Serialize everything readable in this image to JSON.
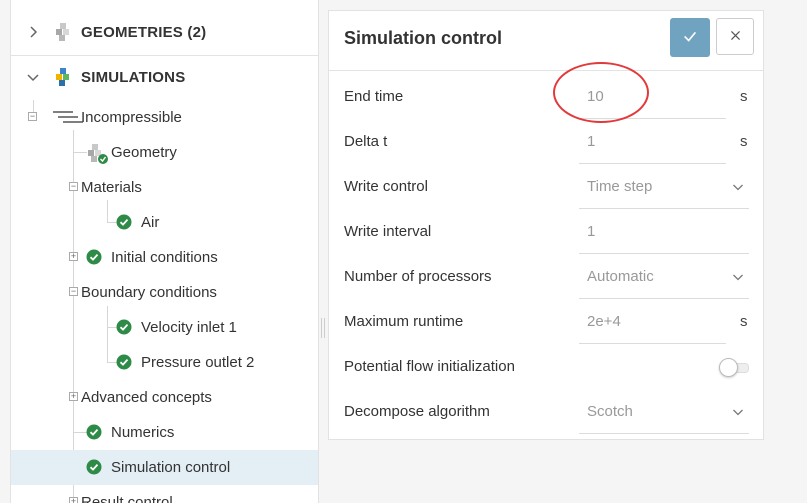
{
  "tree": {
    "geometries_label": "GEOMETRIES (2)",
    "simulations_label": "SIMULATIONS",
    "nodes": {
      "incompressible": "Incompressible",
      "geometry": "Geometry",
      "materials": "Materials",
      "air": "Air",
      "initial_conditions": "Initial conditions",
      "boundary_conditions": "Boundary conditions",
      "velocity_inlet": "Velocity inlet 1",
      "pressure_outlet": "Pressure outlet 2",
      "advanced_concepts": "Advanced concepts",
      "numerics": "Numerics",
      "simulation_control": "Simulation control",
      "result_control": "Result control"
    }
  },
  "panel": {
    "title": "Simulation control",
    "fields": [
      {
        "label": "End time",
        "value": "10",
        "unit": "s"
      },
      {
        "label": "Delta t",
        "value": "1",
        "unit": "s"
      },
      {
        "label": "Write control",
        "value": "Time step"
      },
      {
        "label": "Write interval",
        "value": "1"
      },
      {
        "label": "Number of processors",
        "value": "Automatic"
      },
      {
        "label": "Maximum runtime",
        "value": "2e+4",
        "unit": "s"
      },
      {
        "label": "Potential flow initialization"
      },
      {
        "label": "Decompose algorithm",
        "value": "Scotch"
      }
    ]
  },
  "colors": {
    "accent": "#6fa3c0",
    "check": "#2e8b47",
    "highlight": "#e2393b",
    "selected_row": "#e3eef5"
  }
}
